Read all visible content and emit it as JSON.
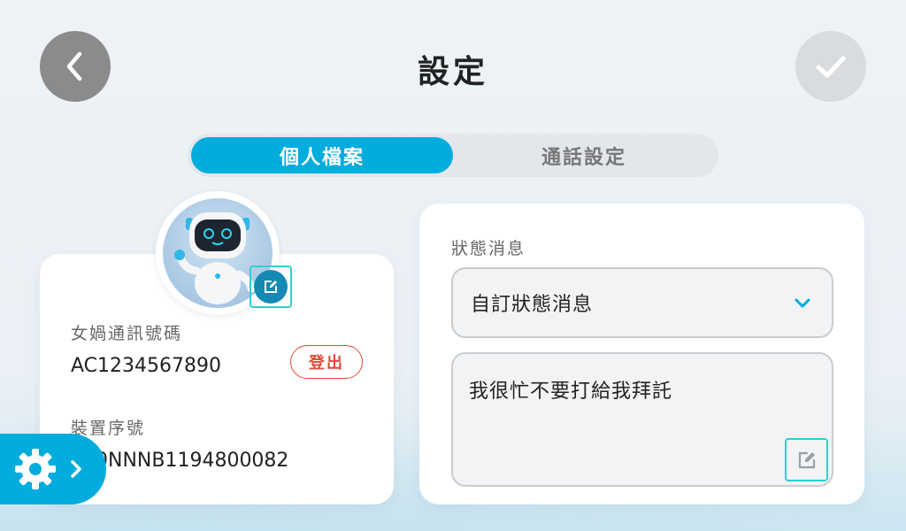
{
  "header": {
    "title": "設定",
    "back_icon": "chevron-left-icon",
    "confirm_icon": "check-icon"
  },
  "tabs": [
    {
      "label": "個人檔案",
      "active": true
    },
    {
      "label": "通話設定",
      "active": false
    }
  ],
  "profile": {
    "avatar_icon": "robot-avatar",
    "nuwa_id_label": "女媧通訊號碼",
    "nuwa_id_value": "AC1234567890",
    "logout_label": "登出",
    "serial_label": "裝置序號",
    "serial_value": "890NNNB1194800082"
  },
  "status": {
    "section_label": "狀態消息",
    "selected_option": "自訂狀態消息",
    "message_text": "我很忙不要打給我拜託"
  },
  "colors": {
    "accent": "#02acdd",
    "logout_red": "#e04a3c",
    "highlight_cyan": "#2fd0d0"
  }
}
